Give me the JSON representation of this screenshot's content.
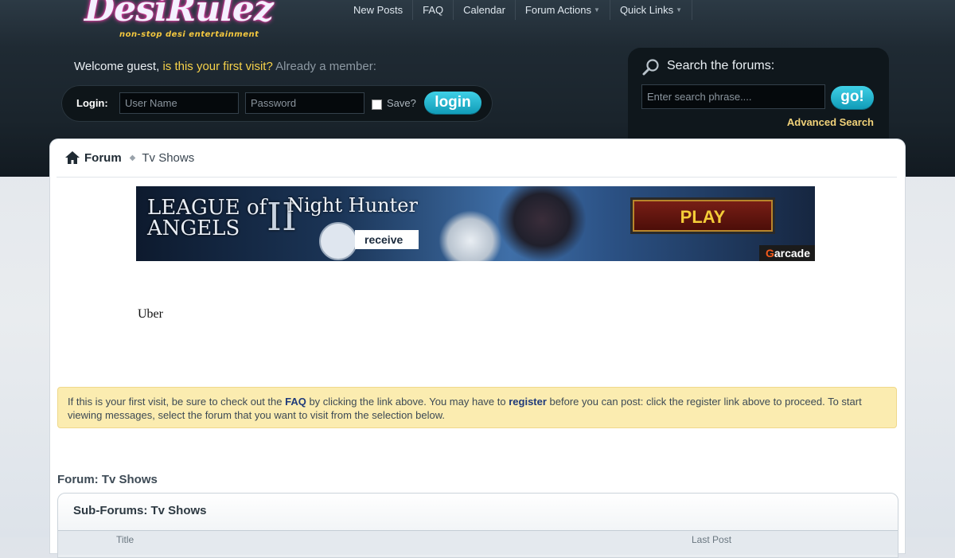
{
  "header": {
    "logo": {
      "wordmark": "DesiRulez",
      "tagline": "non-stop desi entertainment"
    },
    "nav": [
      {
        "label": "New Posts",
        "dropdown": false
      },
      {
        "label": "FAQ",
        "dropdown": false
      },
      {
        "label": "Calendar",
        "dropdown": false
      },
      {
        "label": "Forum Actions",
        "dropdown": true
      },
      {
        "label": "Quick Links",
        "dropdown": true
      }
    ],
    "welcome": {
      "prefix": "Welcome guest, ",
      "first_visit": "is this your first visit?",
      "member": "Already a member:"
    },
    "login": {
      "label": "Login:",
      "username_placeholder": "User Name",
      "password_placeholder": "Password",
      "save_label": "Save?",
      "save_checked": false,
      "button_label": "login"
    },
    "search": {
      "title": "Search the forums:",
      "placeholder": "Enter search phrase....",
      "button_label": "go!",
      "advanced_label": "Advanced Search"
    }
  },
  "breadcrumb": {
    "home": "Forum",
    "current": "Tv Shows"
  },
  "ad": {
    "game_line1": "LEAGUE of",
    "game_line2": "ANGELS",
    "game_numeral": "II",
    "headline": "Night Hunter",
    "cta_receive": "receive",
    "cta_play": "PLAY",
    "brand_mark": "G",
    "brand_text": "arcade"
  },
  "uber_text": "Uber",
  "notice": {
    "part1": "If this is your first visit, be sure to check out the ",
    "faq_link": "FAQ",
    "part2": " by clicking the link above. You may have to ",
    "register_link": "register",
    "part3": " before you can post: click the register link above to proceed. To start viewing messages, select the forum that you want to visit from the selection below."
  },
  "forum": {
    "heading": "Forum: Tv Shows",
    "subforum_title": "Sub-Forums: Tv Shows",
    "columns": {
      "title": "Title",
      "last_post": "Last Post"
    }
  },
  "colors": {
    "accent_cyan": "#1bb2cf",
    "highlight_yellow": "#f6d24a",
    "notice_bg": "#fbecb0",
    "header_bg": "#1a242c"
  }
}
